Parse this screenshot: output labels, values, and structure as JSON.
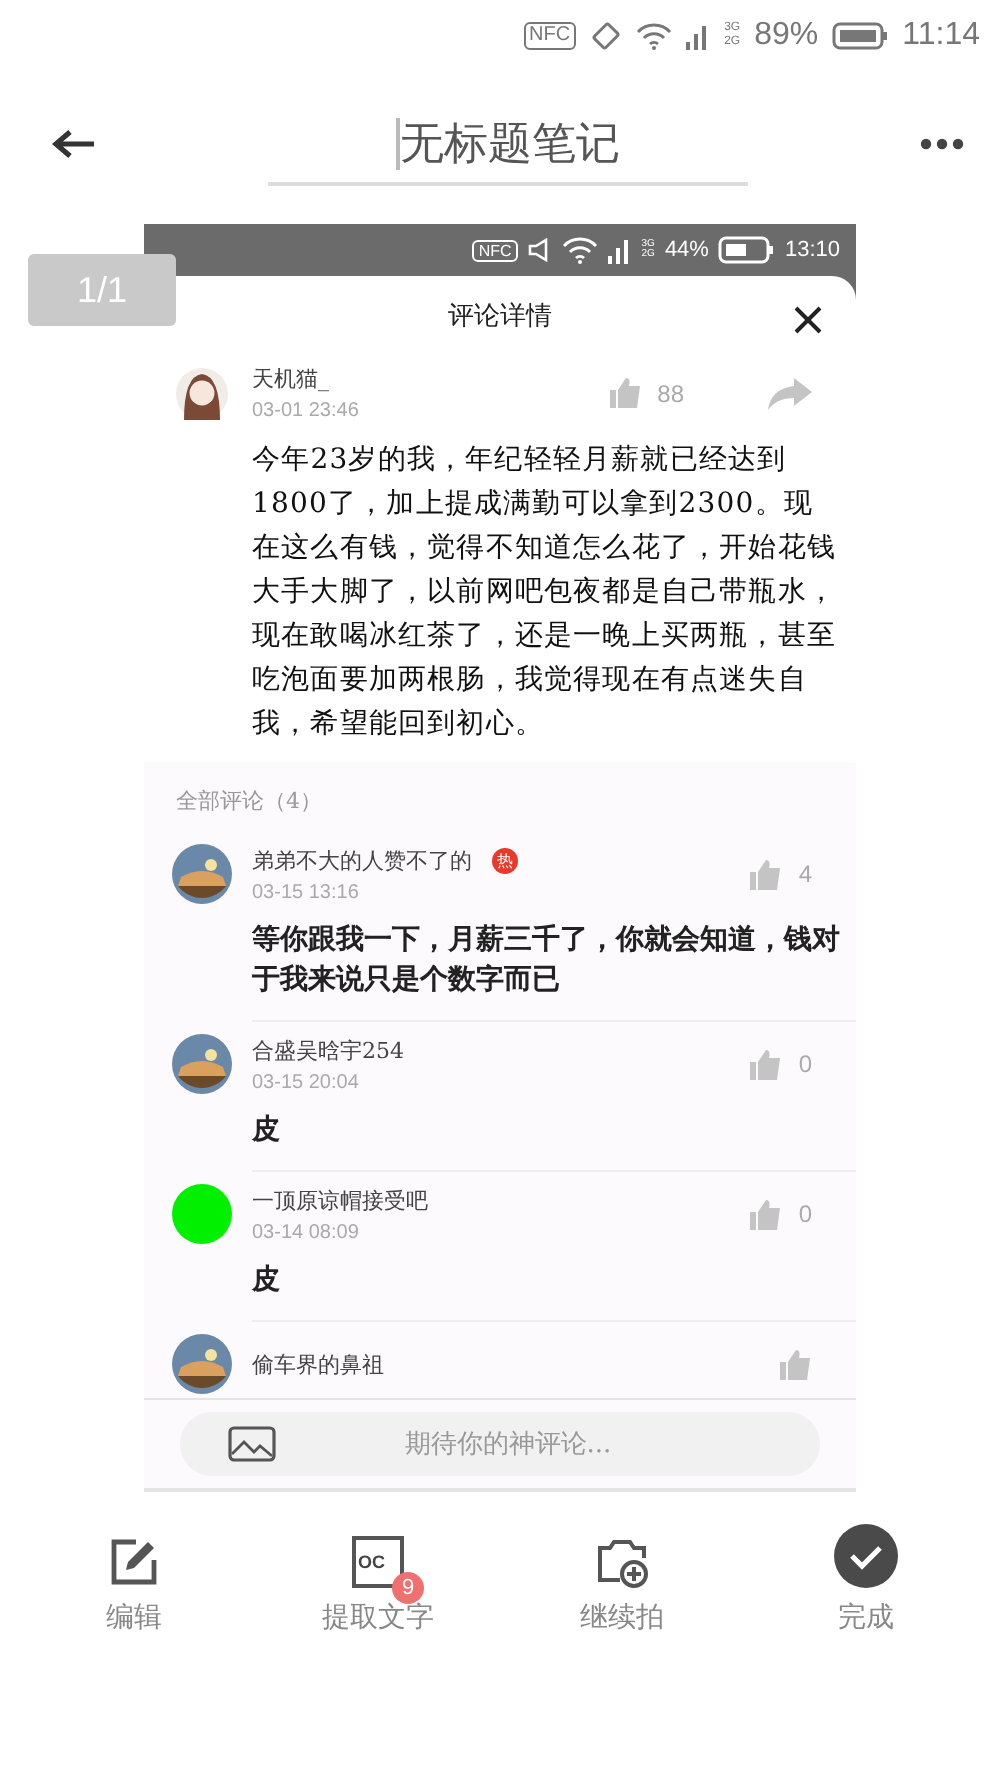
{
  "status_bar": {
    "nfc": "NFC",
    "network": [
      "3G",
      "2G"
    ],
    "battery": "89%",
    "time": "11:14"
  },
  "header": {
    "title": "无标题笔记"
  },
  "page_counter": "1/1",
  "screenshot": {
    "status_bar": {
      "nfc": "NFC",
      "network": [
        "3G",
        "2G"
      ],
      "battery": "44%",
      "time": "13:10"
    },
    "title": "评论详情",
    "post": {
      "author": "天机猫_",
      "date": "03-01 23:46",
      "likes": "88",
      "text": "今年23岁的我，年纪轻轻月薪就已经达到1800了，加上提成满勤可以拿到2300。现在这么有钱，觉得不知道怎么花了，开始花钱大手大脚了，以前网吧包夜都是自己带瓶水，现在敢喝冰红茶了，还是一晚上买两瓶，甚至吃泡面要加两根肠，我觉得现在有点迷失自我，希望能回到初心。"
    },
    "comments_header": "全部评论（4）",
    "comments": [
      {
        "author": "弟弟不大的人赞不了的",
        "badge": "热",
        "date": "03-15 13:16",
        "likes": "4",
        "text": "等你跟我一下，月薪三千了，你就会知道，钱对于我来说只是个数字而已"
      },
      {
        "author": "合盛吴晗宇254",
        "date": "03-15 20:04",
        "likes": "0",
        "text": "皮"
      },
      {
        "kind": "solid",
        "author": "一顶原谅帽接受吧",
        "date": "03-14 08:09",
        "likes": "0",
        "text": "皮"
      },
      {
        "author": "偷车界的鼻祖"
      }
    ],
    "input": {
      "placeholder": "期待你的神评论..."
    }
  },
  "toolbar": [
    {
      "kind": "edit",
      "label": "编辑"
    },
    {
      "kind": "ocr",
      "label": "提取文字",
      "icon_text": "OC",
      "badge": "9"
    },
    {
      "kind": "camera",
      "label": "继续拍"
    },
    {
      "kind": "done",
      "label": "完成"
    }
  ]
}
